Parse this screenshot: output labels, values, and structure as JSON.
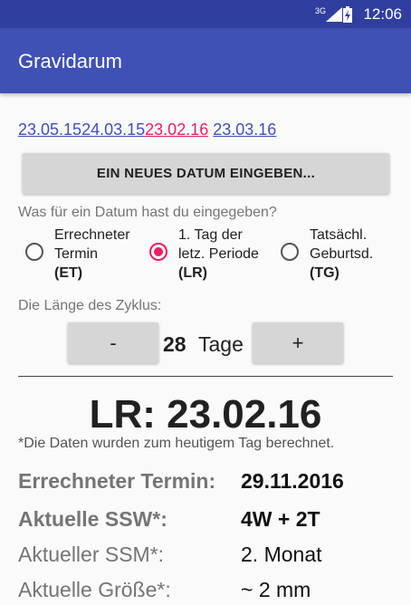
{
  "status_bar": {
    "time": "12:06",
    "network": "3G"
  },
  "app": {
    "title": "Gravidarum"
  },
  "date_history": [
    "23.05.15",
    "24.03.15",
    "23.02.16",
    "23.03.16"
  ],
  "new_date_button": "EIN NEUES DATUM EINGEBEN...",
  "date_type": {
    "question": "Was für ein Datum hast du eingegeben?",
    "options": [
      {
        "line1": "Errechneter",
        "line2": "Termin",
        "code": "(ET)"
      },
      {
        "line1": "1. Tag der",
        "line2": "letz. Periode",
        "code": "(LR)"
      },
      {
        "line1": "Tatsächl.",
        "line2": "Geburtsd.",
        "code": "(TG)"
      }
    ],
    "selected_option": "(LR)"
  },
  "cycle": {
    "label": "Die Länge des Zyklus:",
    "minus_label": "-",
    "value": "28",
    "unit": "Tage",
    "plus_label": "+"
  },
  "result": {
    "date_heading": "LR: 23.02.16",
    "note": "*Die Daten wurden zum heutigem Tag berechnet.",
    "rows": [
      {
        "label": "Errechneter Termin:",
        "value": "29.11.2016"
      },
      {
        "label": "Aktuelle SSW*:",
        "value": "4W + 2T"
      },
      {
        "label": "Aktueller SSM*:",
        "value": "2. Monat"
      },
      {
        "label": "Aktuelle Größe*:",
        "value": "~ 2 mm"
      }
    ]
  },
  "colors": {
    "primary": "#3f51b5",
    "primary_dark": "#303f9f",
    "accent": "#e91e63"
  }
}
